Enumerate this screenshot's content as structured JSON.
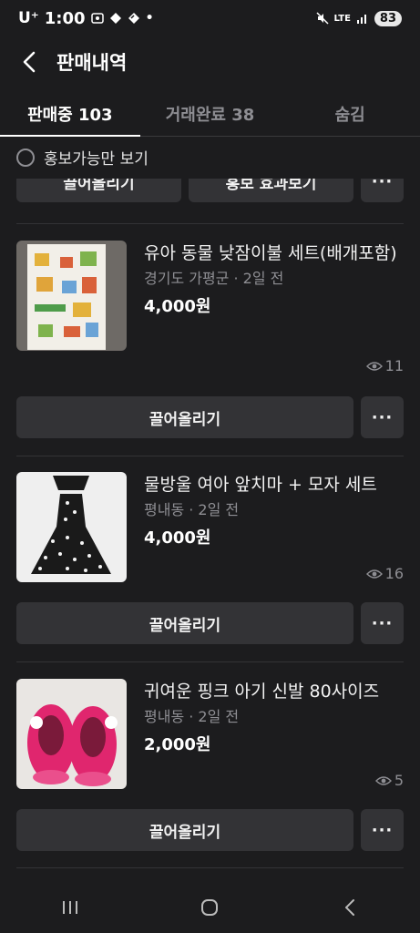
{
  "status_bar": {
    "carrier": "U⁺",
    "time": "1:00",
    "network": "LTE",
    "battery": "83"
  },
  "header": {
    "title": "판매내역"
  },
  "tabs": [
    {
      "label": "판매중 103",
      "active": true
    },
    {
      "label": "거래완료 38",
      "active": false
    },
    {
      "label": "숨김",
      "active": false
    }
  ],
  "filter": {
    "label": "홍보가능만 보기"
  },
  "partial_row": {
    "bump_label": "끌어올리기",
    "promote_label": "홍보 효과보기",
    "more_label": "···"
  },
  "items": [
    {
      "title": "유아 동물  낮잠이불 세트(배개포함)",
      "meta": "경기도 가평군 · 2일 전",
      "price": "4,000원",
      "views": "11",
      "bump_label": "끌어올리기",
      "more_label": "···"
    },
    {
      "title": "물방울 여아 앞치마 + 모자 세트",
      "meta": "평내동 · 2일 전",
      "price": "4,000원",
      "views": "16",
      "bump_label": "끌어올리기",
      "more_label": "···"
    },
    {
      "title": "귀여운 핑크 아기 신발 80사이즈",
      "meta": "평내동 · 2일 전",
      "price": "2,000원",
      "views": "5",
      "bump_label": "끌어올리기",
      "more_label": "···"
    }
  ],
  "colors": {
    "background": "#1c1c1e",
    "button": "#333336",
    "muted_text": "#8e8e93"
  },
  "icons": {
    "back": "chevron-left-icon",
    "views": "eye-icon",
    "nav_recent": "recent-apps-icon",
    "nav_home": "home-icon",
    "nav_back": "back-icon"
  }
}
